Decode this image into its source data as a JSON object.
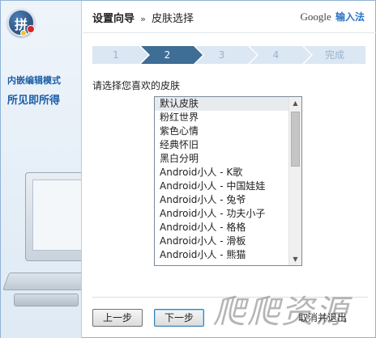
{
  "sidebar": {
    "logo_char": "拼",
    "label_1": "内嵌编辑模式",
    "label_2": "所见即所得"
  },
  "header": {
    "breadcrumb_main": "设置向导",
    "breadcrumb_sep": "»",
    "breadcrumb_sub": "皮肤选择",
    "google": "Google",
    "ime": "输入法"
  },
  "steps": [
    "1",
    "2",
    "3",
    "4",
    "完成"
  ],
  "active_step": "2",
  "prompt": "请选择您喜欢的皮肤",
  "skins": {
    "selected": "默认皮肤",
    "items": [
      "默认皮肤",
      "粉红世界",
      "紫色心情",
      "经典怀旧",
      "黑白分明",
      "Android小人 - K歌",
      "Android小人 - 中国娃娃",
      "Android小人 - 兔爷",
      "Android小人 - 功夫小子",
      "Android小人 - 格格",
      "Android小人 - 滑板",
      "Android小人 - 熊猫"
    ]
  },
  "buttons": {
    "prev": "上一步",
    "next": "下一步",
    "cancel": "取消并退出"
  },
  "watermark": "爬爬资源"
}
